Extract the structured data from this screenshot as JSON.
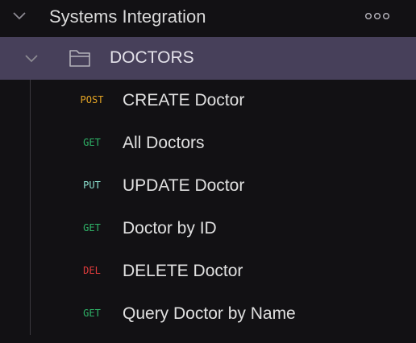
{
  "collection": {
    "title": "Systems Integration",
    "expand_icon": "chevron-down-icon",
    "menu_icon": "more-options-icon"
  },
  "folder": {
    "label": "DOCTORS",
    "expand_icon": "chevron-down-icon",
    "icon": "folder-icon"
  },
  "requests": [
    {
      "method": "POST",
      "name": "CREATE Doctor",
      "method_color": "#e4a424"
    },
    {
      "method": "GET",
      "name": "All Doctors",
      "method_color": "#2fb468"
    },
    {
      "method": "PUT",
      "name": "UPDATE Doctor",
      "method_color": "#8be0cf"
    },
    {
      "method": "GET",
      "name": "Doctor by ID",
      "method_color": "#2fb468"
    },
    {
      "method": "DEL",
      "name": "DELETE Doctor",
      "method_color": "#e03c3c"
    },
    {
      "method": "GET",
      "name": "Query Doctor by Name",
      "method_color": "#2fb468"
    }
  ],
  "colors": {
    "background": "#121114",
    "folder_highlight": "#47405a",
    "text": "#e0e0e0"
  }
}
